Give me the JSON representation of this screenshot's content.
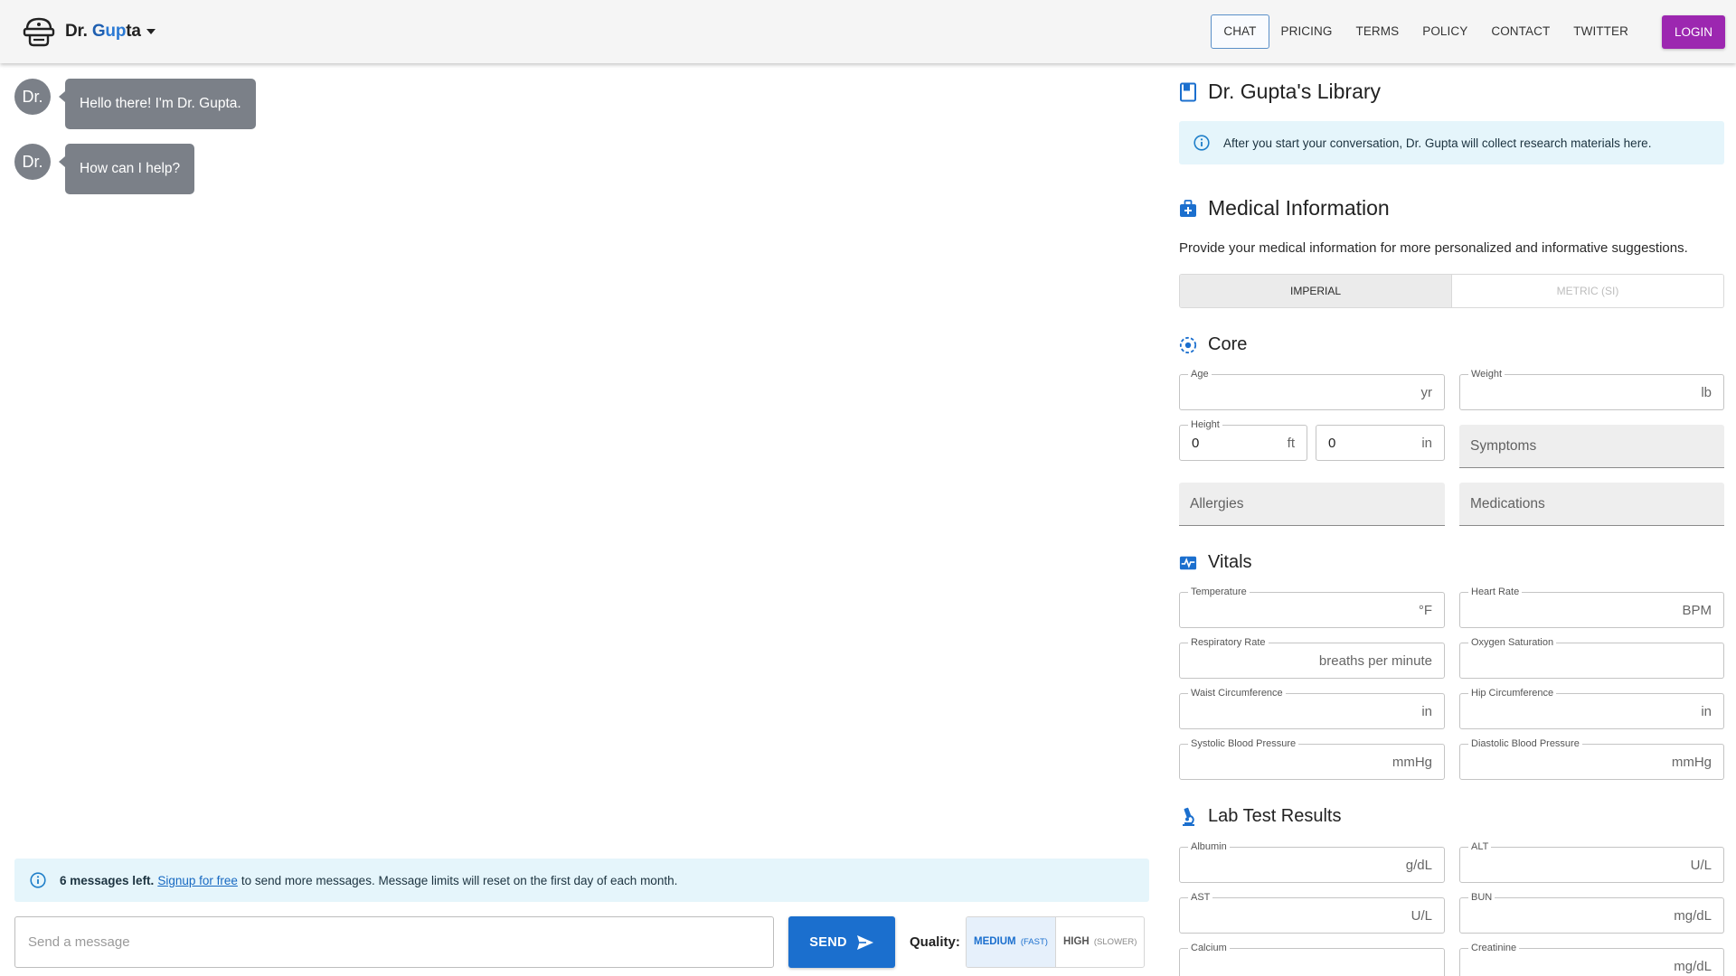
{
  "nav": {
    "brand": {
      "prefix": "Dr. ",
      "g1": "G",
      "g2": "up",
      "rest": "ta"
    },
    "items": [
      {
        "label": "CHAT",
        "active": true
      },
      {
        "label": "PRICING",
        "active": false
      },
      {
        "label": "TERMS",
        "active": false
      },
      {
        "label": "POLICY",
        "active": false
      },
      {
        "label": "CONTACT",
        "active": false
      },
      {
        "label": "TWITTER",
        "active": false
      }
    ],
    "login_label": "LOGIN"
  },
  "chat": {
    "avatar_text": "Dr.",
    "messages": [
      "Hello there! I'm Dr. Gupta.",
      "How can I help?"
    ]
  },
  "banner": {
    "count_text": "6 messages left.",
    "signup_text": "Signup for free",
    "rest_text": "to send more messages. Message limits will reset on the first day of each month."
  },
  "composer": {
    "placeholder": "Send a message",
    "send_label": "SEND",
    "quality_label": "Quality:",
    "options": [
      {
        "label": "MEDIUM",
        "note": "(FAST)",
        "selected": true
      },
      {
        "label": "HIGH",
        "note": "(SLOWER)",
        "selected": false
      }
    ]
  },
  "library": {
    "title": "Dr. Gupta's Library",
    "info": "After you start your conversation, Dr. Gupta will collect research materials here."
  },
  "medical": {
    "title": "Medical Information",
    "description": "Provide your medical information for more personalized and informative suggestions.",
    "unit_options": [
      "IMPERIAL",
      "METRIC (SI)"
    ],
    "selected_unit": "IMPERIAL"
  },
  "core": {
    "title": "Core",
    "age": {
      "label": "Age",
      "unit": "yr",
      "value": ""
    },
    "weight": {
      "label": "Weight",
      "unit": "lb",
      "value": ""
    },
    "height": {
      "label": "Height",
      "ft_value": "0",
      "ft_unit": "ft",
      "in_value": "0",
      "in_unit": "in"
    },
    "symptoms": "Symptoms",
    "allergies": "Allergies",
    "medications": "Medications"
  },
  "vitals": {
    "title": "Vitals",
    "fields": [
      {
        "label": "Temperature",
        "unit": "°F"
      },
      {
        "label": "Heart Rate",
        "unit": "BPM"
      },
      {
        "label": "Respiratory Rate",
        "unit": "breaths per minute"
      },
      {
        "label": "Oxygen Saturation",
        "unit": ""
      },
      {
        "label": "Waist Circumference",
        "unit": "in"
      },
      {
        "label": "Hip Circumference",
        "unit": "in"
      },
      {
        "label": "Systolic Blood Pressure",
        "unit": "mmHg"
      },
      {
        "label": "Diastolic Blood Pressure",
        "unit": "mmHg"
      }
    ]
  },
  "labs": {
    "title": "Lab Test Results",
    "fields": [
      {
        "label": "Albumin",
        "unit": "g/dL"
      },
      {
        "label": "ALT",
        "unit": "U/L"
      },
      {
        "label": "AST",
        "unit": "U/L"
      },
      {
        "label": "BUN",
        "unit": "mg/dL"
      },
      {
        "label": "Calcium",
        "unit": ""
      },
      {
        "label": "Creatinine",
        "unit": "mg/dL"
      }
    ]
  },
  "colors": {
    "accent": "#1b6fce",
    "login": "#9c27b0",
    "bubble": "#7b8088",
    "info_bg": "#e5f5fb"
  },
  "icons": [
    "brand-logo-icon",
    "caret-down-icon",
    "info-icon",
    "send-icon",
    "book-icon",
    "medical-kit-icon",
    "core-target-icon",
    "vitals-pulse-icon",
    "microscope-icon"
  ]
}
